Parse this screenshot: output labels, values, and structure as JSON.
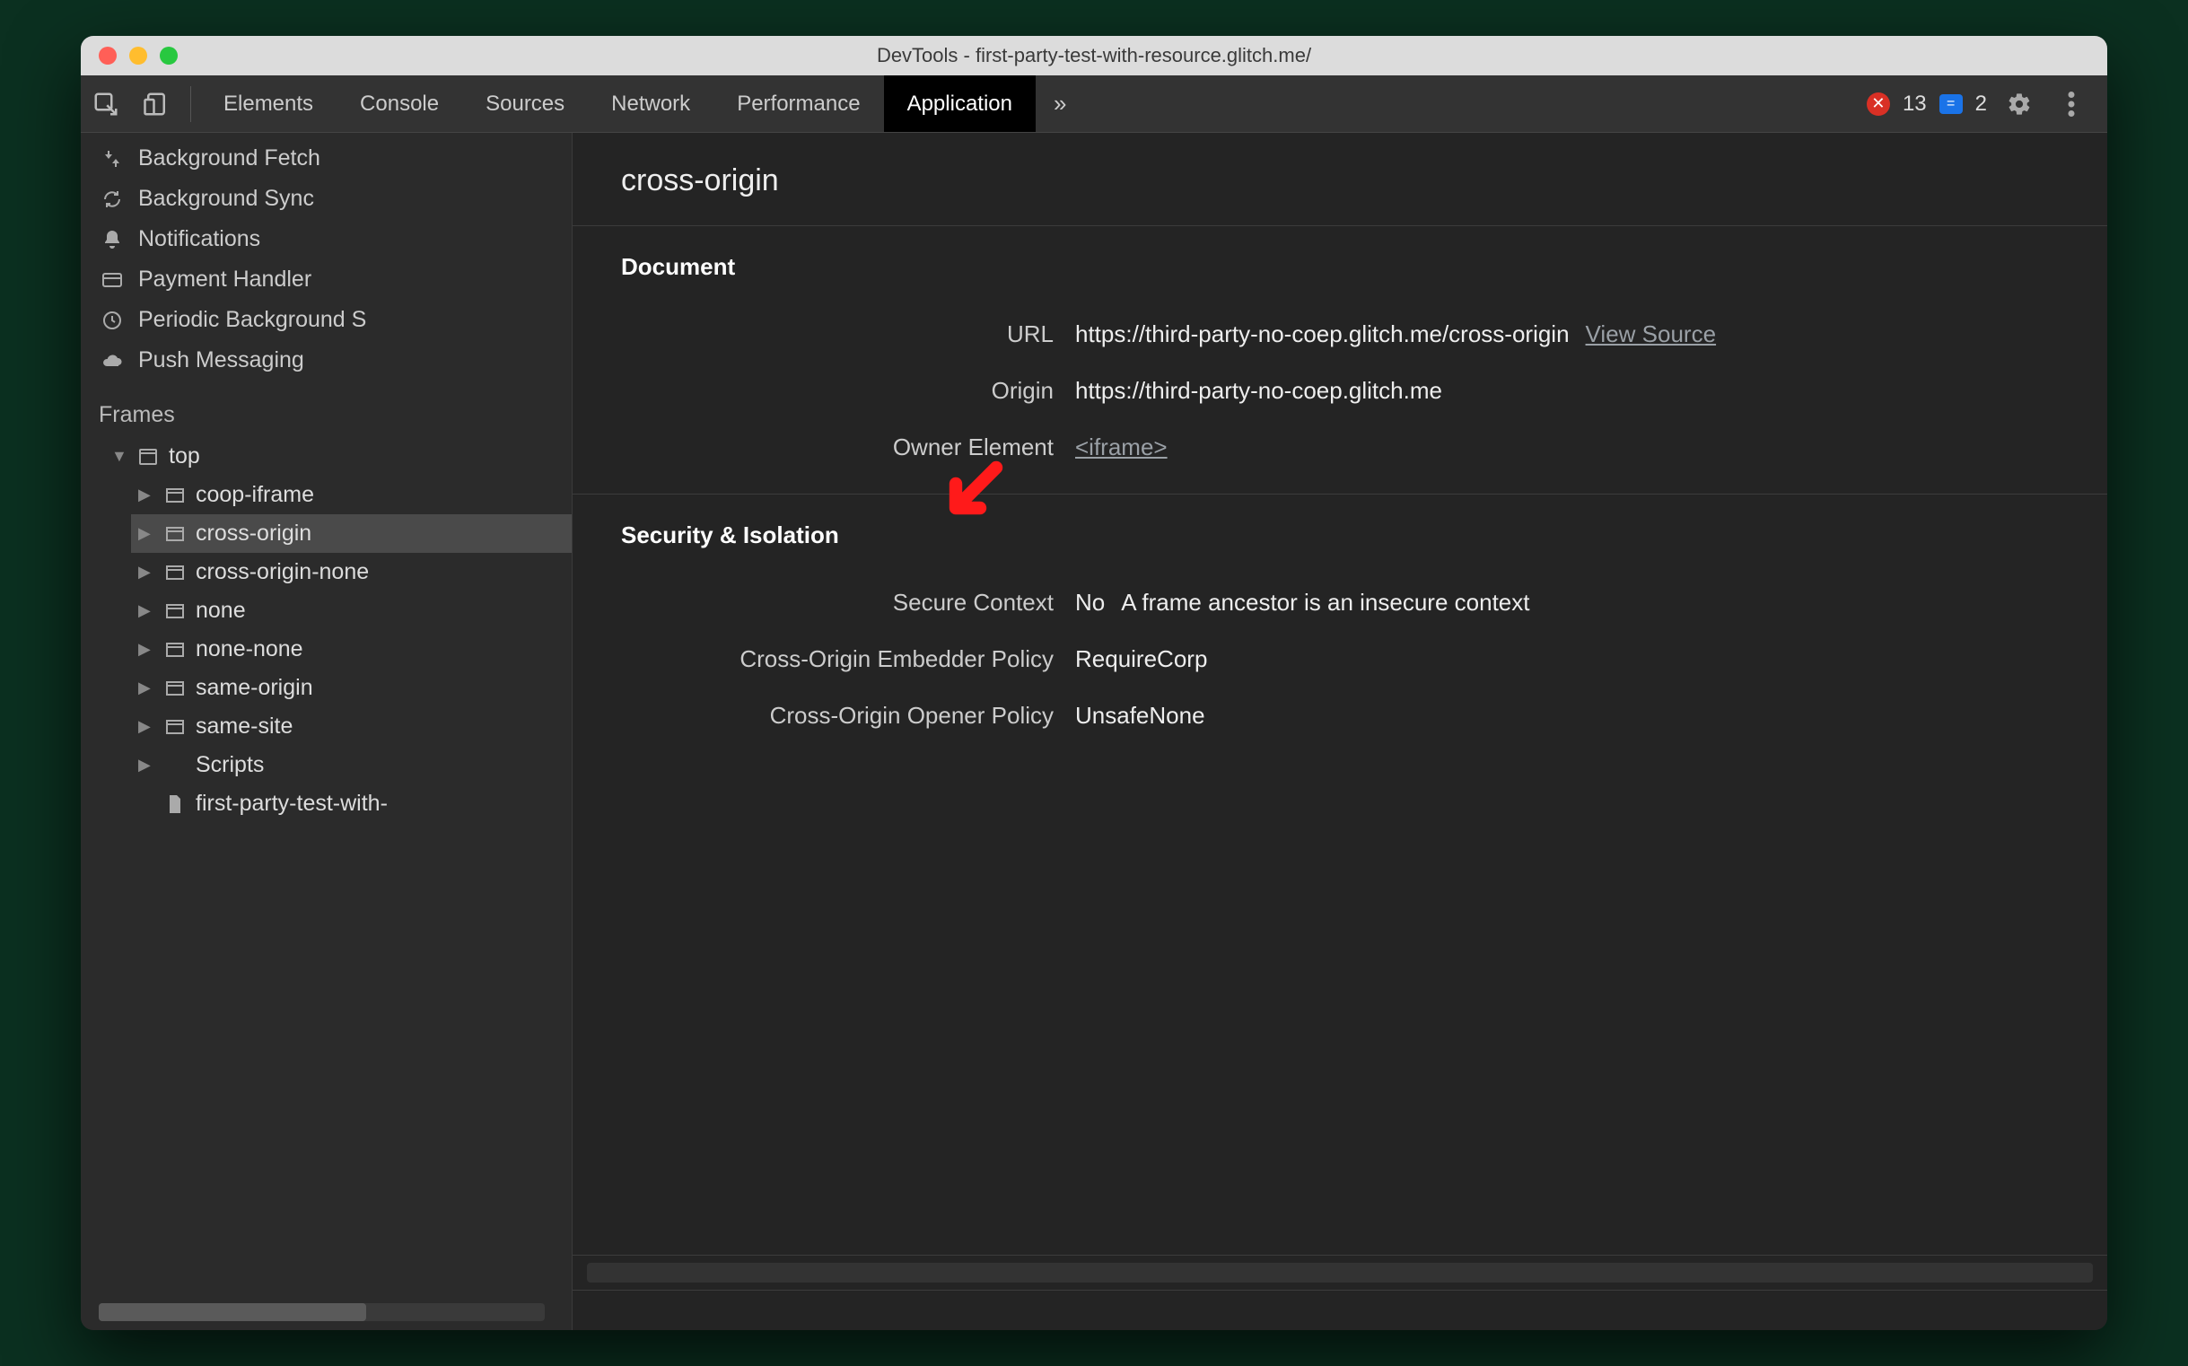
{
  "window": {
    "title": "DevTools - first-party-test-with-resource.glitch.me/"
  },
  "toolbar": {
    "tabs": [
      "Elements",
      "Console",
      "Sources",
      "Network",
      "Performance",
      "Application"
    ],
    "active_tab_index": 5,
    "more_glyph": "»",
    "errors_badge": {
      "count": "13",
      "color": "#d93025"
    },
    "info_badge": {
      "count": "2",
      "color": "#1a73e8",
      "glyph": "="
    }
  },
  "sidebar": {
    "items": [
      {
        "icon": "background-fetch-icon",
        "label": "Background Fetch"
      },
      {
        "icon": "background-sync-icon",
        "label": "Background Sync"
      },
      {
        "icon": "bell-icon",
        "label": "Notifications"
      },
      {
        "icon": "credit-card-icon",
        "label": "Payment Handler"
      },
      {
        "icon": "clock-icon",
        "label": "Periodic Background S"
      },
      {
        "icon": "cloud-icon",
        "label": "Push Messaging"
      }
    ],
    "frames_header": "Frames",
    "tree": {
      "top_label": "top",
      "children": [
        {
          "label": "coop-iframe"
        },
        {
          "label": "cross-origin",
          "selected": true
        },
        {
          "label": "cross-origin-none"
        },
        {
          "label": "none"
        },
        {
          "label": "none-none"
        },
        {
          "label": "same-origin"
        },
        {
          "label": "same-site"
        },
        {
          "label": "Scripts",
          "is_folder": true
        },
        {
          "label": "first-party-test-with-",
          "is_file": true
        }
      ]
    }
  },
  "panel": {
    "title": "cross-origin",
    "sections": [
      {
        "heading": "Document",
        "rows": [
          {
            "key": "URL",
            "value": "https://third-party-no-coep.glitch.me/cross-origin",
            "link_label": "View Source"
          },
          {
            "key": "Origin",
            "value": "https://third-party-no-coep.glitch.me"
          },
          {
            "key": "Owner Element",
            "link_value": "<iframe>"
          }
        ]
      },
      {
        "heading": "Security & Isolation",
        "rows": [
          {
            "key": "Secure Context",
            "value": "No",
            "extra": "A frame ancestor is an insecure context"
          },
          {
            "key": "Cross-Origin Embedder Policy",
            "value": "RequireCorp"
          },
          {
            "key": "Cross-Origin Opener Policy",
            "value": "UnsafeNone"
          }
        ]
      }
    ]
  }
}
